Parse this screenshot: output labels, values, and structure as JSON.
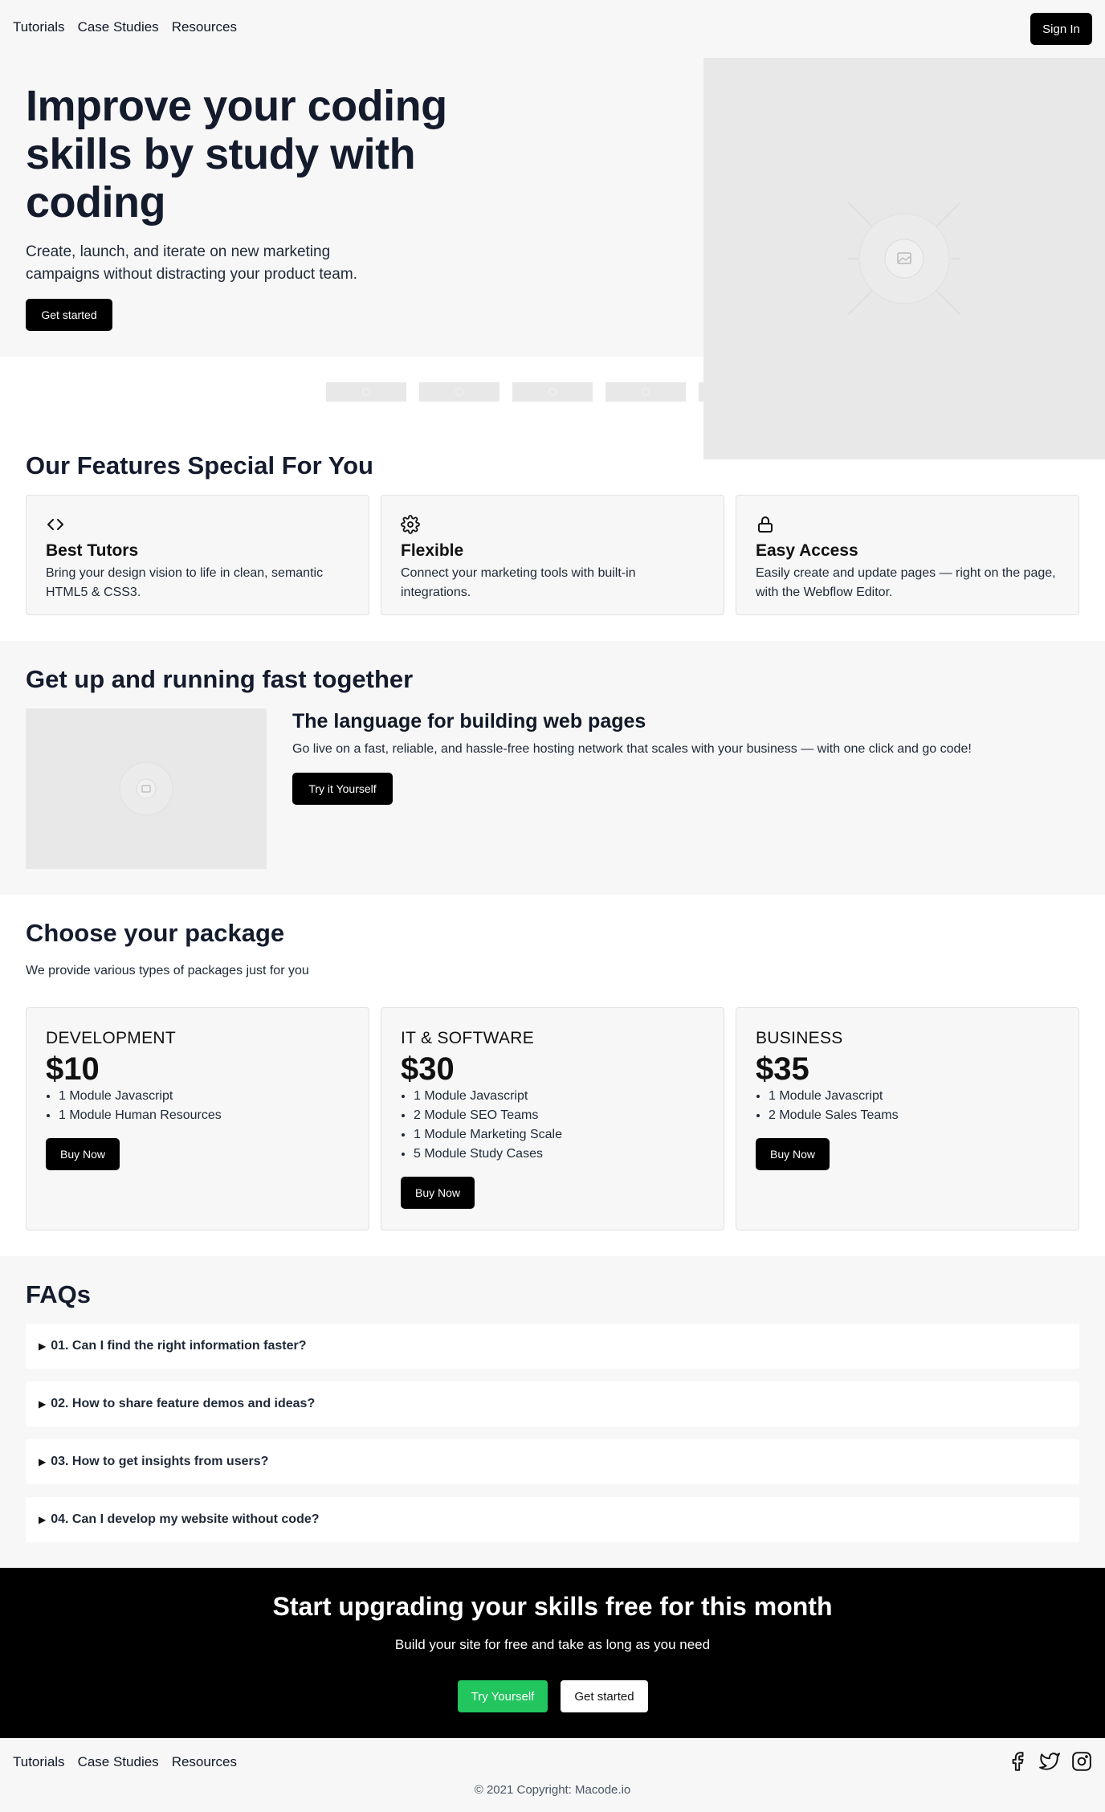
{
  "header": {
    "nav": [
      "Tutorials",
      "Case Studies",
      "Resources"
    ],
    "signin_label": "Sign In"
  },
  "hero": {
    "title": "Improve your coding skills by study with coding",
    "subtitle": "Create, launch, and iterate on new marketing campaigns without distracting your product team.",
    "cta_label": "Get started"
  },
  "features": {
    "title": "Our Features Special For You",
    "items": [
      {
        "icon": "code-icon",
        "title": "Best Tutors",
        "text": "Bring your design vision to life in clean, semantic HTML5 & CSS3."
      },
      {
        "icon": "gear-icon",
        "title": "Flexible",
        "text": "Connect your marketing tools with built-in integrations."
      },
      {
        "icon": "lock-icon",
        "title": "Easy Access",
        "text": "Easily create and update pages — right on the page, with the Webflow Editor."
      }
    ]
  },
  "running": {
    "title": "Get up and running fast together",
    "heading": "The language for building web pages",
    "text": "Go live on a fast, reliable, and hassle-free hosting network that scales with your business — with one click and go code!",
    "button_label": "Try it Yourself"
  },
  "packages": {
    "title": "Choose your package",
    "subtitle": "We provide various types of packages just for you",
    "items": [
      {
        "name": "DEVELOPMENT",
        "price": "$10",
        "features": [
          "1 Module Javascript",
          "1 Module Human Resources"
        ],
        "button": "Buy Now"
      },
      {
        "name": "IT & SOFTWARE",
        "price": "$30",
        "features": [
          "1 Module Javascript",
          "2 Module SEO Teams",
          "1 Module Marketing Scale",
          "5 Module Study Cases"
        ],
        "button": "Buy Now"
      },
      {
        "name": "BUSINESS",
        "price": "$35",
        "features": [
          "1 Module Javascript",
          "2 Module Sales Teams"
        ],
        "button": "Buy Now"
      }
    ]
  },
  "faqs": {
    "title": "FAQs",
    "items": [
      "01. Can I find the right information faster?",
      "02. How to share feature demos and ideas?",
      "03. How to get insights from users?",
      "04. Can I develop my website without code?"
    ]
  },
  "cta": {
    "title": "Start upgrading your skills free for this month",
    "subtitle": "Build your site for free and take as long as you need",
    "primary_label": "Try Yourself",
    "secondary_label": "Get started",
    "primary_color": "#22c55e"
  },
  "footer": {
    "nav": [
      "Tutorials",
      "Case Studies",
      "Resources"
    ],
    "social": [
      "facebook-icon",
      "twitter-icon",
      "instagram-icon"
    ],
    "copyright": "© 2021 Copyright: Macode.io"
  }
}
